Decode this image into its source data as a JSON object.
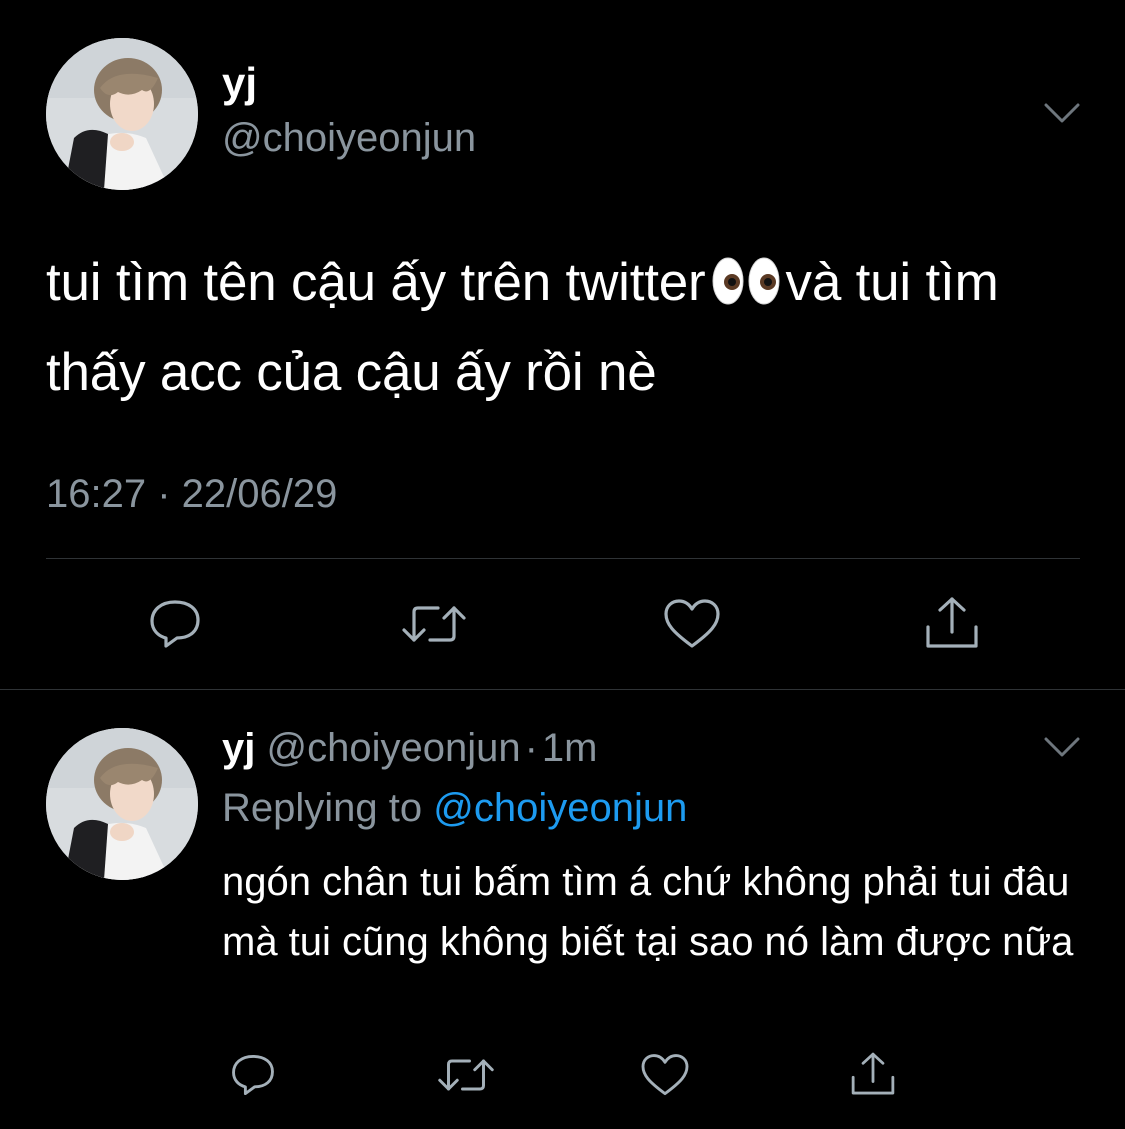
{
  "colors": {
    "background": "#000000",
    "text": "#ffffff",
    "secondary": "#8a959e",
    "link": "#1d9bf0",
    "divider": "#2f3336",
    "icon": "#a4b0b9"
  },
  "main_tweet": {
    "name": "yj",
    "handle": "@choiyeonjun",
    "text_before_emoji": "tui tìm tên cậu ấy trên twitter",
    "emoji": "eyes-emoji",
    "text_after_emoji": "và tui tìm thấy acc của cậu ấy rồi nè",
    "timestamp": "16:27 · 22/06/29",
    "actions": [
      "reply-icon",
      "retweet-icon",
      "like-icon",
      "share-icon"
    ]
  },
  "reply_tweet": {
    "name": "yj",
    "handle": "@choiyeonjun",
    "separator": "·",
    "time": "1m",
    "replying_to_label": "Replying to",
    "replying_to_handle": "@choiyeonjun",
    "text": "ngón chân tui bấm tìm á chứ không phải tui đâu mà tui cũng không biết tại sao nó làm được nữa",
    "actions": [
      "reply-icon",
      "retweet-icon",
      "like-icon",
      "share-icon"
    ]
  }
}
